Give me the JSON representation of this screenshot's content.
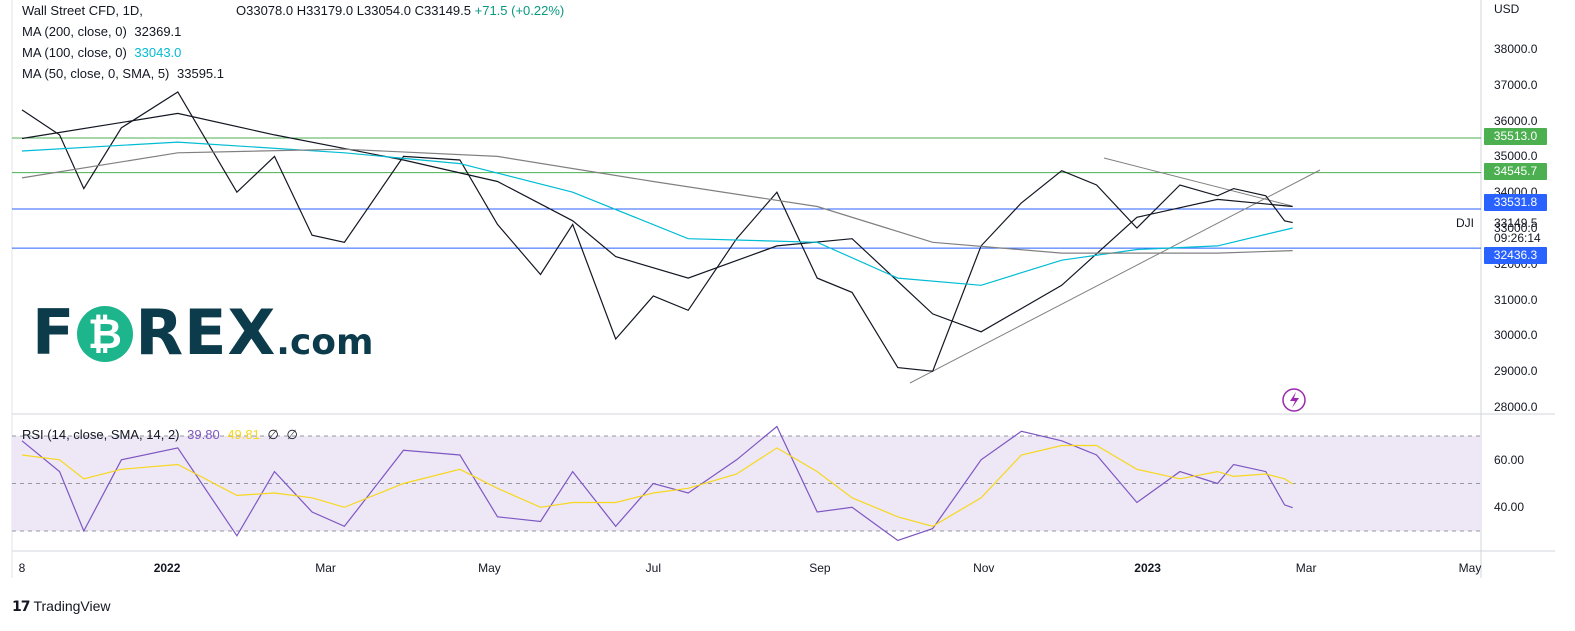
{
  "header": {
    "symbol": "Wall Street CFD, 1D,",
    "open": "O33078.0",
    "high": "H33179.0",
    "low": "L33054.0",
    "close": "C33149.5",
    "change": "+71.5 (+0.22%)"
  },
  "indicators": [
    {
      "label": "MA (200, close, 0)",
      "value": "32369.1",
      "color": "#131722"
    },
    {
      "label": "MA (100, close, 0)",
      "value": "33043.0",
      "color": "#00bcd4"
    },
    {
      "label": "MA (50, close, 0, SMA, 5)",
      "value": "33595.1",
      "color": "#131722"
    }
  ],
  "rsi_legend": {
    "label": "RSI (14, close, SMA, 14, 2)",
    "rsi": "39.80",
    "sma": "49.81",
    "extra1": "∅",
    "extra2": "∅"
  },
  "axis": {
    "currency": "USD",
    "price_ticks": [
      "38000.0",
      "37000.0",
      "36000.0",
      "35000.0",
      "34000.0",
      "33000.0",
      "32000.0",
      "31000.0",
      "30000.0",
      "29000.0",
      "28000.0"
    ],
    "rsi_ticks": [
      "60.00",
      "40.00"
    ],
    "time_ticks": [
      "8",
      "2022",
      "Mar",
      "May",
      "Jul",
      "Sep",
      "Nov",
      "2023",
      "Mar",
      "May"
    ]
  },
  "price_tags": [
    {
      "value": "35513.0",
      "color": "#4caf50"
    },
    {
      "value": "34545.7",
      "color": "#4caf50"
    },
    {
      "value": "33531.8",
      "color": "#2962ff"
    },
    {
      "value": "32436.3",
      "color": "#2962ff"
    }
  ],
  "last_price": {
    "symbol": "DJI",
    "value": "33149.5",
    "countdown": "09:26:14"
  },
  "logo": {
    "left": "F",
    "o": "₿",
    "right": "REX",
    "suffix": ".com"
  },
  "footer": {
    "brand": "TradingView"
  },
  "chart_data": {
    "type": "line",
    "title": "Wall Street CFD, 1D",
    "y_range": [
      28000,
      38500
    ],
    "horizontal_levels": [
      35513.0,
      34545.7,
      33531.8,
      32436.3
    ],
    "series": [
      {
        "name": "Wall Street CFD",
        "x": [
          "2021-11-08",
          "2021-11-22",
          "2021-12-01",
          "2021-12-15",
          "2022-01-05",
          "2022-01-27",
          "2022-02-10",
          "2022-02-24",
          "2022-03-08",
          "2022-03-30",
          "2022-04-20",
          "2022-05-04",
          "2022-05-20",
          "2022-06-01",
          "2022-06-17",
          "2022-07-01",
          "2022-07-14",
          "2022-08-01",
          "2022-08-16",
          "2022-08-31",
          "2022-09-13",
          "2022-09-30",
          "2022-10-13",
          "2022-10-31",
          "2022-11-15",
          "2022-11-30",
          "2022-12-13",
          "2022-12-28",
          "2023-01-13",
          "2023-01-27",
          "2023-02-02",
          "2023-02-14",
          "2023-02-21",
          "2023-02-24"
        ],
        "values": [
          36300,
          35600,
          34100,
          35800,
          36800,
          34000,
          35000,
          32800,
          32600,
          35000,
          34900,
          33100,
          31700,
          33100,
          29900,
          31100,
          30700,
          32700,
          34000,
          31600,
          31200,
          29100,
          29000,
          32500,
          33700,
          34600,
          34200,
          33000,
          34200,
          33900,
          34100,
          33900,
          33200,
          33149.5
        ]
      },
      {
        "name": "MA (50, close, 0, SMA, 5)",
        "x": [
          "2021-11-08",
          "2022-01-05",
          "2022-02-10",
          "2022-03-30",
          "2022-05-04",
          "2022-06-01",
          "2022-06-17",
          "2022-07-14",
          "2022-08-16",
          "2022-09-13",
          "2022-10-13",
          "2022-10-31",
          "2022-11-30",
          "2022-12-28",
          "2023-01-27",
          "2023-02-24"
        ],
        "values": [
          35500,
          36200,
          35600,
          34900,
          34300,
          33200,
          32200,
          31600,
          32500,
          32700,
          30600,
          30100,
          31400,
          33300,
          33800,
          33600
        ]
      },
      {
        "name": "MA (100, close, 0)",
        "x": [
          "2021-11-08",
          "2022-01-05",
          "2022-03-08",
          "2022-04-20",
          "2022-06-01",
          "2022-07-14",
          "2022-08-31",
          "2022-09-30",
          "2022-10-31",
          "2022-11-30",
          "2022-12-28",
          "2023-01-27",
          "2023-02-24"
        ],
        "values": [
          35150,
          35400,
          35100,
          34800,
          34000,
          32700,
          32600,
          31600,
          31400,
          32100,
          32400,
          32500,
          33000
        ]
      },
      {
        "name": "MA (200, close, 0)",
        "x": [
          "2021-11-08",
          "2022-01-05",
          "2022-03-08",
          "2022-05-04",
          "2022-07-01",
          "2022-08-31",
          "2022-10-13",
          "2022-11-30",
          "2023-01-27",
          "2023-02-24"
        ],
        "values": [
          34400,
          35100,
          35200,
          35000,
          34300,
          33600,
          32600,
          32300,
          32300,
          32369.1
        ]
      }
    ],
    "rsi": {
      "range": [
        25,
        77
      ],
      "bands": [
        30,
        50,
        70
      ],
      "x": [
        "2021-11-08",
        "2021-11-22",
        "2021-12-01",
        "2021-12-15",
        "2022-01-05",
        "2022-01-27",
        "2022-02-10",
        "2022-02-24",
        "2022-03-08",
        "2022-03-30",
        "2022-04-20",
        "2022-05-04",
        "2022-05-20",
        "2022-06-01",
        "2022-06-17",
        "2022-07-01",
        "2022-07-14",
        "2022-08-01",
        "2022-08-16",
        "2022-08-31",
        "2022-09-13",
        "2022-09-30",
        "2022-10-13",
        "2022-10-31",
        "2022-11-15",
        "2022-11-30",
        "2022-12-13",
        "2022-12-28",
        "2023-01-13",
        "2023-01-27",
        "2023-02-02",
        "2023-02-14",
        "2023-02-21",
        "2023-02-24"
      ],
      "rsi": [
        68,
        55,
        30,
        60,
        65,
        28,
        55,
        38,
        32,
        64,
        62,
        36,
        34,
        55,
        32,
        50,
        46,
        60,
        74,
        38,
        40,
        26,
        31,
        60,
        72,
        68,
        62,
        42,
        55,
        50,
        58,
        55,
        41,
        39.8
      ],
      "sma": [
        62,
        60,
        52,
        56,
        58,
        45,
        46,
        44,
        40,
        50,
        56,
        48,
        40,
        42,
        42,
        46,
        48,
        54,
        65,
        55,
        44,
        36,
        32,
        44,
        62,
        66,
        66,
        56,
        52,
        55,
        53,
        54,
        52,
        49.81
      ]
    }
  }
}
